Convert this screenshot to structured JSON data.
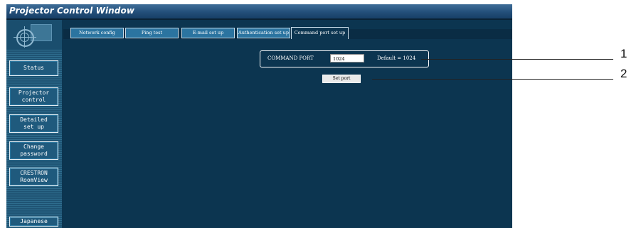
{
  "window": {
    "title": "Projector Control Window"
  },
  "sidebar": {
    "items": [
      {
        "label": "Status"
      },
      {
        "label": "Projector control"
      },
      {
        "label": "Detailed set up"
      },
      {
        "label": "Change password"
      },
      {
        "label": "CRESTRON RoomView"
      },
      {
        "label": "Japanese"
      }
    ]
  },
  "tabs": [
    {
      "label": "Network config"
    },
    {
      "label": "Ping test"
    },
    {
      "label": "E-mail set up"
    },
    {
      "label": "Authentication set up"
    },
    {
      "label": "Command port set up",
      "active": true
    }
  ],
  "command_port": {
    "label": "COMMAND PORT",
    "value": "1024",
    "default_text": "Default = 1024",
    "set_button_label": "Set port"
  },
  "callouts": [
    {
      "number": "1"
    },
    {
      "number": "2"
    }
  ],
  "colors": {
    "background": "#0c3550",
    "titlebar": "#234f7a",
    "tab": "#2b74a0",
    "button": "#1f5a7d"
  }
}
